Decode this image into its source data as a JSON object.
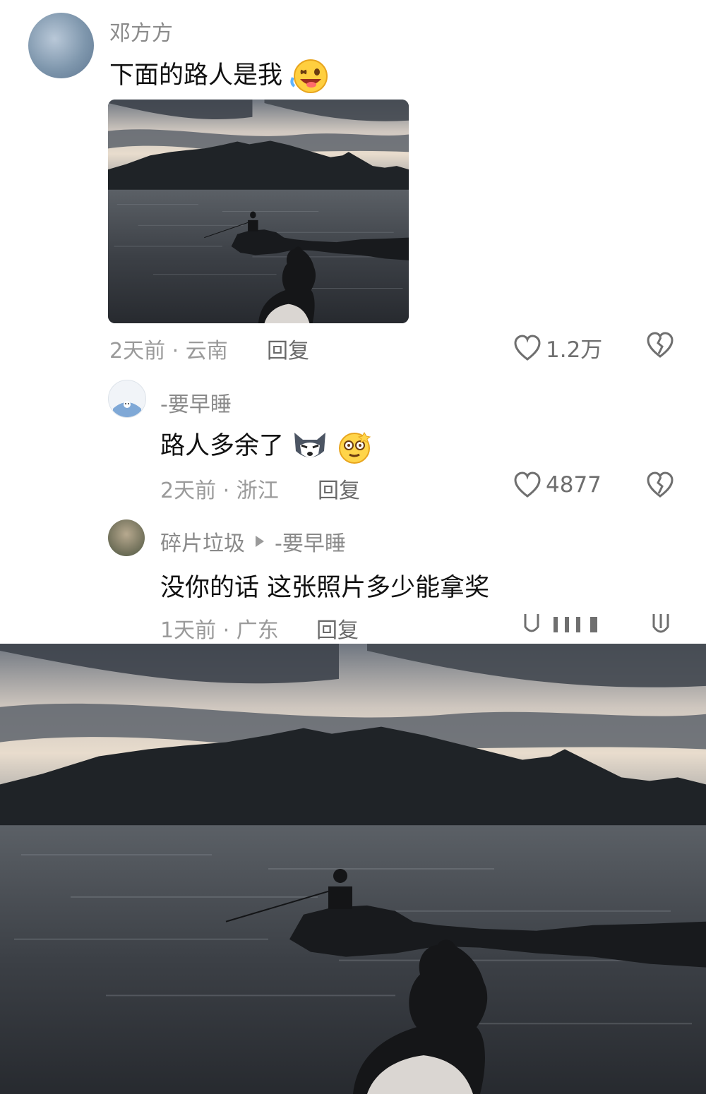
{
  "comments": [
    {
      "username": "邓方方",
      "text": "下面的路人是我",
      "emoji": "grinning-wink-emoji",
      "meta": "2天前 · 云南",
      "reply_label": "回复",
      "likes": "1.2万"
    },
    {
      "username": "-要早睡",
      "text": "路人多余了",
      "emojis": [
        "husky-emoji",
        "dizzy-face-emoji"
      ],
      "meta": "2天前 · 浙江",
      "reply_label": "回复",
      "likes": "4877"
    },
    {
      "username": "碎片垃圾",
      "reply_to": "-要早睡",
      "text": "没你的话 这张照片多少能拿奖",
      "meta": "1天前 · 广东",
      "reply_label": "回复"
    }
  ],
  "colors": {
    "text": "#111111",
    "meta": "#9a9a9a",
    "icon": "#6f6f6f"
  }
}
